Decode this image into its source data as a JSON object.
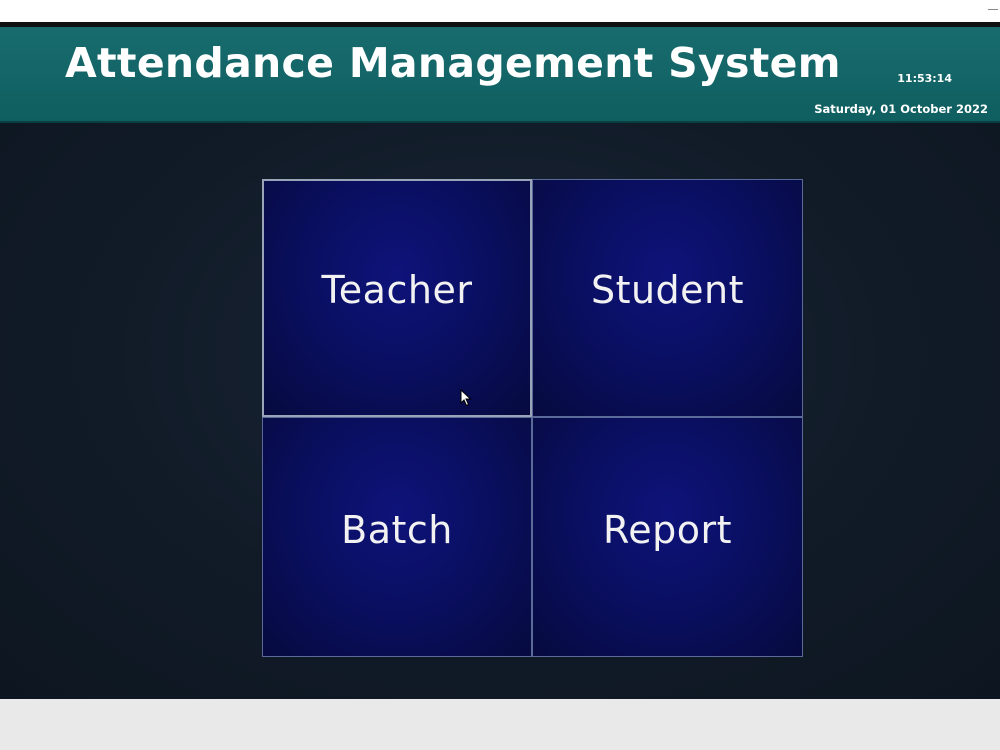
{
  "header": {
    "title": "Attendance Management System",
    "time": "11:53:14",
    "date": "Saturday, 01 October 2022"
  },
  "menu": {
    "tiles": [
      {
        "label": "Teacher"
      },
      {
        "label": "Student"
      },
      {
        "label": "Batch"
      },
      {
        "label": "Report"
      }
    ]
  },
  "colors": {
    "header_bg": "#186c6e",
    "tile_bg": "#0a0f62",
    "page_bg": "#111b28"
  },
  "icons": {
    "cursor": "mouse-pointer-icon"
  }
}
